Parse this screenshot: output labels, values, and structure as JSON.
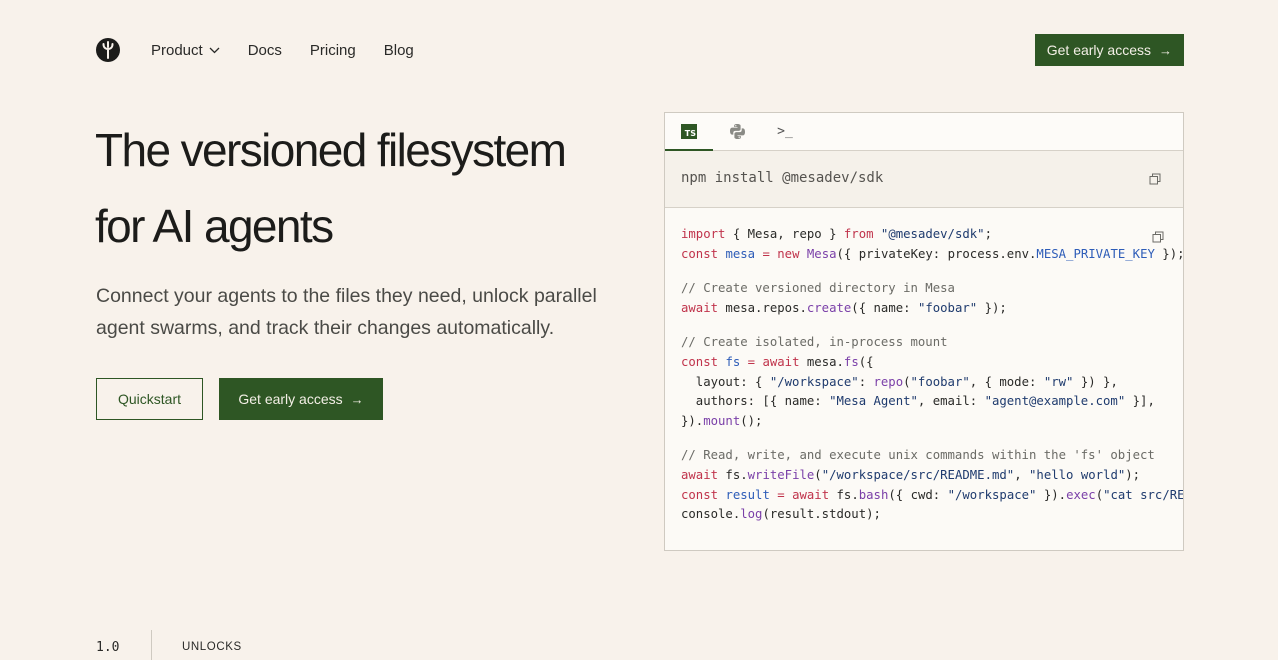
{
  "nav": {
    "links": [
      "Product",
      "Docs",
      "Pricing",
      "Blog"
    ],
    "cta": "Get early access",
    "cta_arrow": "→"
  },
  "hero": {
    "title_line1": "The versioned filesystem",
    "title_line2": "for AI agents",
    "subtitle": "Connect your agents to the files they need, unlock parallel agent swarms, and track their changes automatically.",
    "quickstart": "Quickstart",
    "cta": "Get early access",
    "cta_arrow": "→"
  },
  "code_panel": {
    "tabs": [
      "TS",
      "python",
      ">_"
    ],
    "install_command": "npm install @mesadev/sdk"
  },
  "footer": {
    "version": "1.0",
    "label": "UNLOCKS"
  },
  "colors": {
    "background": "#f8f2eb",
    "accent": "#2e5624"
  }
}
